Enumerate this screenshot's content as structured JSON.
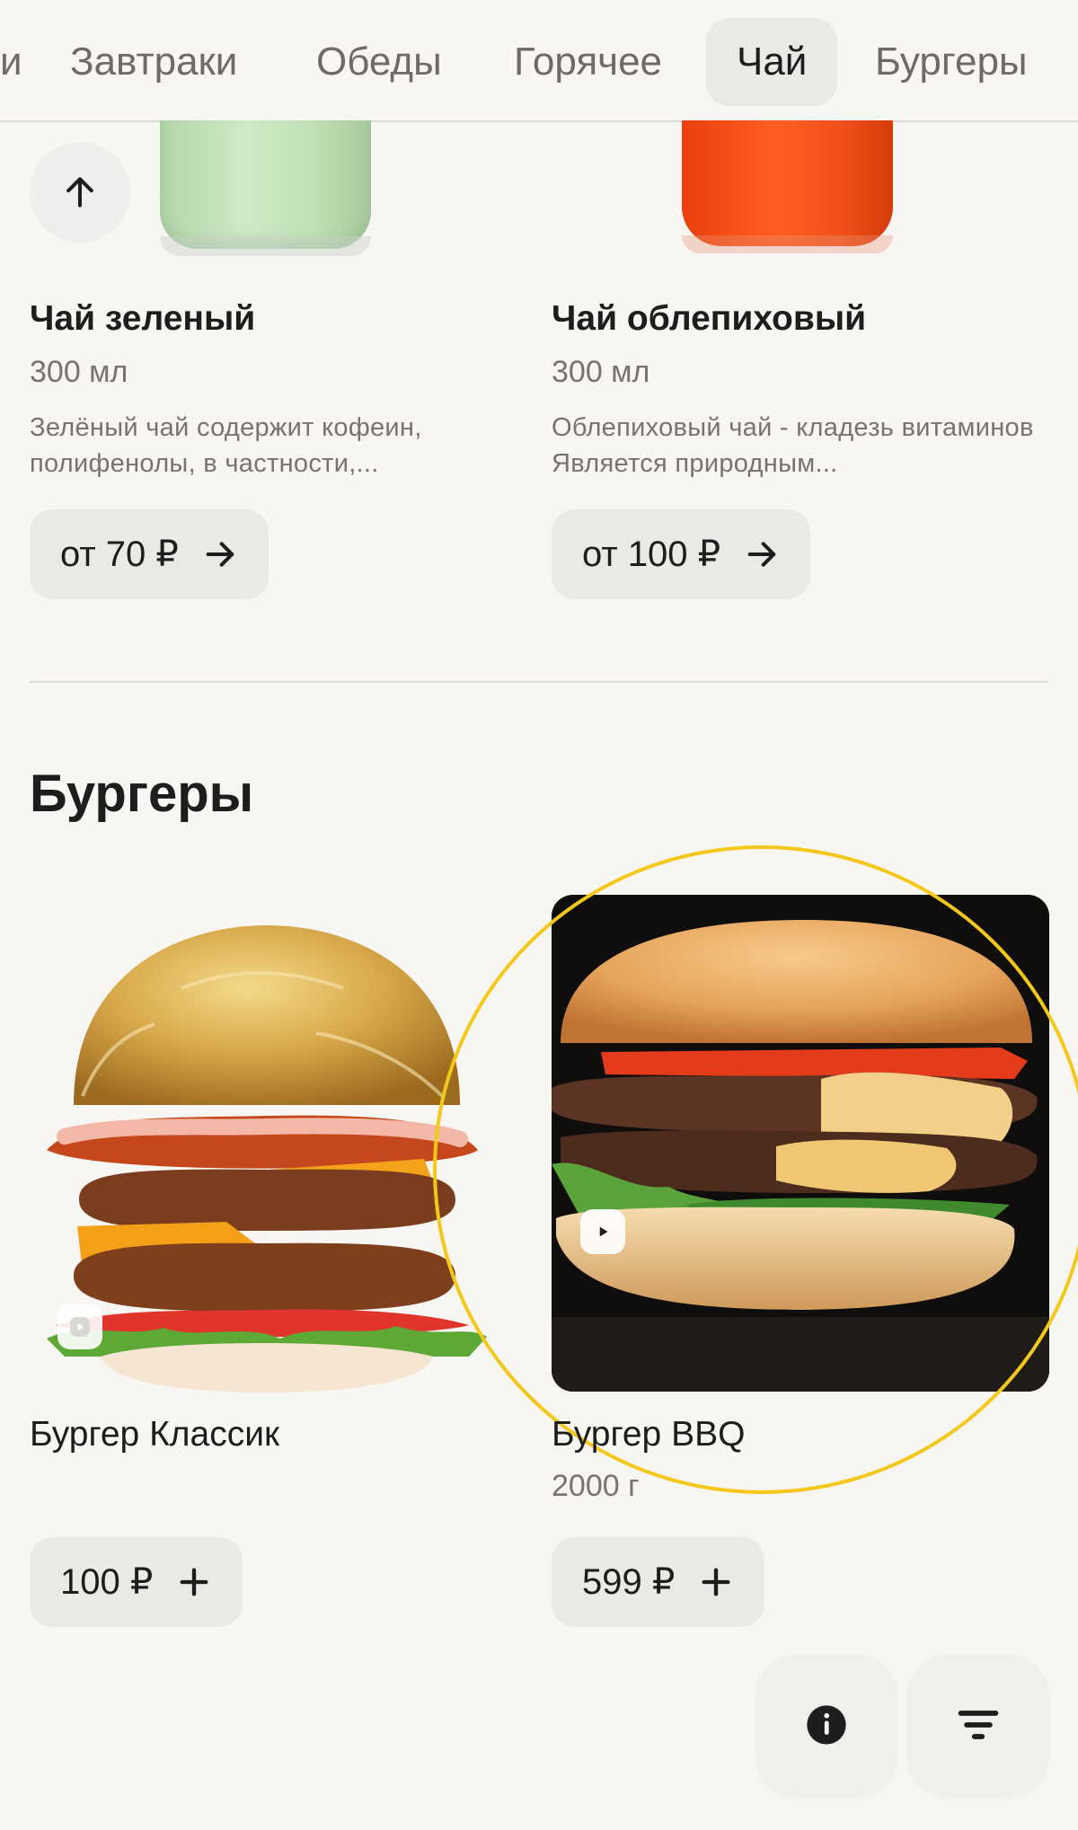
{
  "nav": {
    "categories": [
      {
        "label": "и"
      },
      {
        "label": "Завтраки"
      },
      {
        "label": "Обеды"
      },
      {
        "label": "Горячее"
      },
      {
        "label": "Чай",
        "active": true
      },
      {
        "label": "Бургеры"
      }
    ]
  },
  "tea": {
    "items": [
      {
        "name": "Чай зеленый",
        "weight": "300 мл",
        "description": "Зелёный чай содержит кофеин, полифенолы, в частности,...",
        "price": "от 70 ₽"
      },
      {
        "name": "Чай облепиховый",
        "weight": "300 мл",
        "description": "Облепиховый чай - кладезь витаминов Является природным...",
        "price": "от 100 ₽"
      }
    ]
  },
  "burgers": {
    "title": "Бургеры",
    "items": [
      {
        "name": "Бургер Классик",
        "weight": "",
        "price": "100 ₽"
      },
      {
        "name": "Бургер BBQ",
        "weight": "2000 г",
        "price": "599 ₽"
      }
    ]
  },
  "colors": {
    "background": "#f8f6f2",
    "button": "#ebe9e6",
    "highlight": "#f3c81b",
    "text": "#1d1d1d",
    "muted": "#77736e"
  },
  "icons": {
    "scroll_up": "arrow-up-icon",
    "price_arrow": "arrow-right-icon",
    "add": "plus-icon",
    "video": "play-icon",
    "info": "info-icon",
    "filter": "filter-icon"
  }
}
